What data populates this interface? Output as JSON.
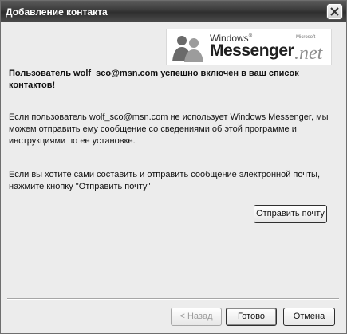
{
  "window": {
    "title": "Добавление контакта"
  },
  "logo": {
    "windows": "Windows",
    "messenger": "Messenger",
    "microsoft": "Microsoft",
    "net": ".net"
  },
  "message": {
    "success": "Пользователь wolf_sco@msn.com успешно включен в ваш список контактов!",
    "para1": "Если пользователь wolf_sco@msn.com не использует Windows Messenger, мы можем отправить ему сообщение со сведениями об этой программе и инструкциями по ее установке.",
    "para2": "Если вы хотите сами составить и отправить сообщение электронной почты, нажмите кнопку \"Отправить почту\""
  },
  "buttons": {
    "send_mail": "Отправить почту",
    "back": "< Назад",
    "done": "Готово",
    "cancel": "Отмена"
  },
  "icons": {
    "close": "close-icon",
    "logo_people": "messenger-people-icon"
  }
}
